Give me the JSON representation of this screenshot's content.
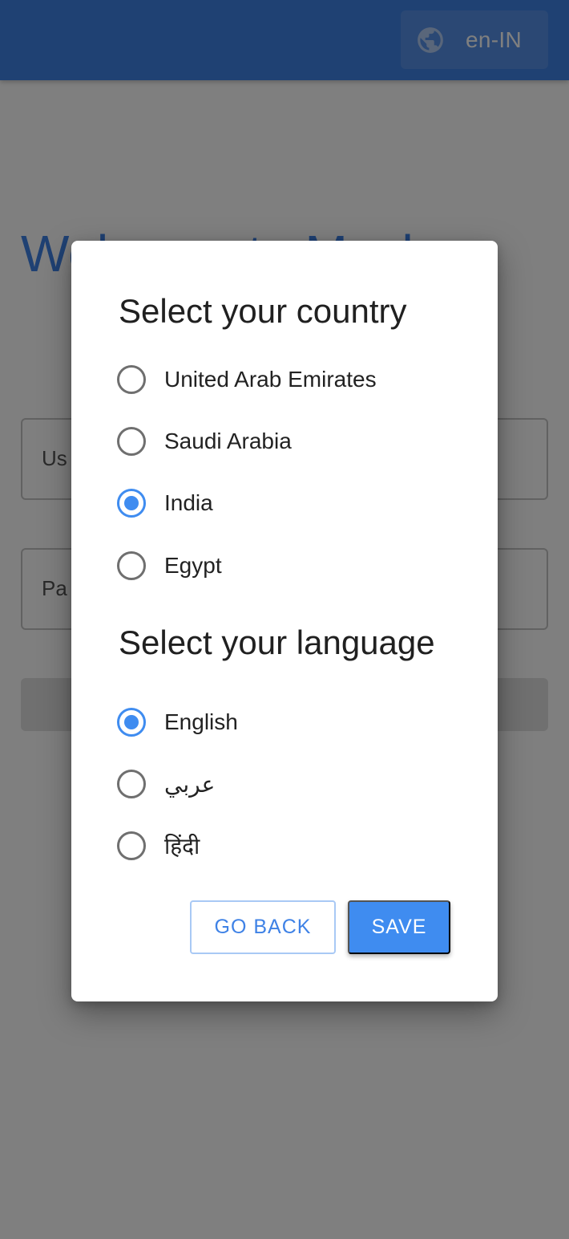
{
  "colors": {
    "primary": "#3f82e6",
    "radio_selected": "#3f8cf0",
    "scrim": "rgba(0,0,0,0.5)"
  },
  "appbar": {
    "locale_icon": "globe-icon",
    "locale_label": "en-IN"
  },
  "background_page": {
    "welcome_title": "Welcome to Mach as",
    "username_label": "Us",
    "password_label": "Pa"
  },
  "dialog": {
    "country_heading": "Select your country",
    "countries": [
      {
        "label": "United Arab Emirates",
        "selected": false
      },
      {
        "label": "Saudi Arabia",
        "selected": false
      },
      {
        "label": "India",
        "selected": true
      },
      {
        "label": "Egypt",
        "selected": false
      }
    ],
    "language_heading": "Select your language",
    "languages": [
      {
        "label": "English",
        "selected": true
      },
      {
        "label": "عربي",
        "selected": false
      },
      {
        "label": "हिंदी",
        "selected": false
      }
    ],
    "go_back_label": "GO BACK",
    "save_label": "SAVE"
  }
}
